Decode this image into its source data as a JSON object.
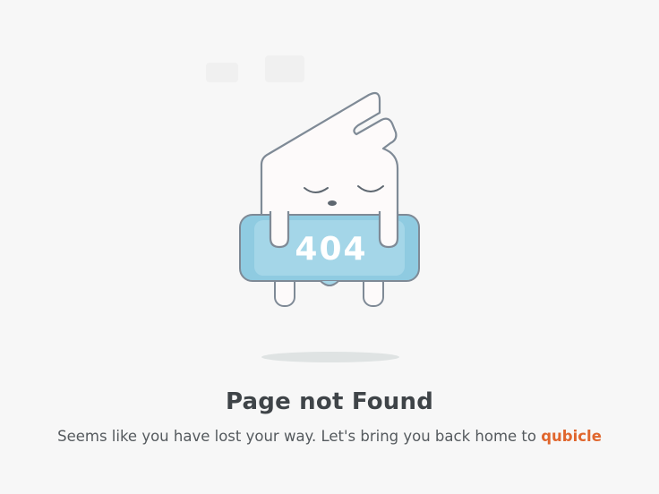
{
  "illustration": {
    "code_text": "404",
    "outline_color": "#7f8a96",
    "body_color": "#fdfafa",
    "badge_color": "#8fcbe1",
    "badge_inner_color": "#a4d6e8"
  },
  "message": {
    "title": "Page not Found",
    "subtitle": "Seems like you have lost your way. Let's bring you back home to",
    "link_label": "qubicle",
    "link_color": "#e0662d"
  }
}
